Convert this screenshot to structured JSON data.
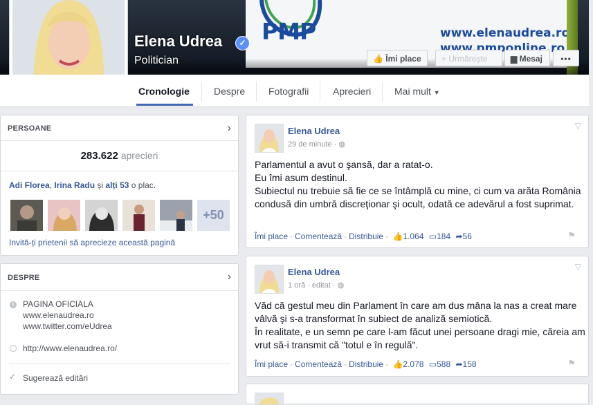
{
  "cover": {
    "logo_text": "PMP",
    "site_line1": "www.elenaudrea.ro",
    "site_line2": "www.pmponline.ro"
  },
  "page": {
    "name": "Elena Udrea",
    "category": "Politician"
  },
  "buttons": {
    "like": "Îmi place",
    "follow": "Urmărește",
    "message": "Mesaj",
    "more": "•••"
  },
  "tabs": [
    "Cronologie",
    "Despre",
    "Fotografii",
    "Aprecieri",
    "Mai mult"
  ],
  "people": {
    "header": "PERSOANE",
    "likes_count": "283.622",
    "likes_label": "aprecieri",
    "friends_line": {
      "name1": "Adi Florea",
      "sep": ", ",
      "name2": "Irina Radu",
      "and": " și ",
      "others": "alți 53",
      "tail": " o plac."
    },
    "more_friends": "+50",
    "invite": "Invită-ți prietenii să aprecieze această pagină"
  },
  "about": {
    "header": "DESPRE",
    "official_title": "PAGINA OFICIALA",
    "official_link1": "www.elenaudrea.ro",
    "official_link2": "www.twitter.com/eUdrea",
    "website": "http://www.elenaudrea.ro/",
    "suggest": "Sugerează editări"
  },
  "posts": [
    {
      "author": "Elena Udrea",
      "time": "29 de minute",
      "edited": "",
      "body": "Parlamentul a avut o şansă, dar a ratat-o.\nEu îmi asum destinul.\nSubiectul nu trebuie să fie ce se întâmplă cu mine, ci cum va arăta România condusă din umbră discreţionar şi ocult, odată ce adevărul a fost suprimat.",
      "like": "Îmi place",
      "comment": "Comentează",
      "share": "Distribuie",
      "likes": "1.064",
      "comments": "184",
      "shares": "56"
    },
    {
      "author": "Elena Udrea",
      "time": "1 oră",
      "edited": "editat",
      "body": "Văd că gestul meu din Parlament în care am dus mâna la nas a creat mare vâlvă şi s-a transformat în subiect de analiză semiotică.\nÎn realitate, e un semn pe care l-am făcut unei persoane dragi mie, căreia am vrut să-i transmit că \"totul e în regulă\".",
      "like": "Îmi place",
      "comment": "Comentează",
      "share": "Distribuie",
      "likes": "2.078",
      "comments": "588",
      "shares": "158"
    }
  ],
  "colors": {
    "fb_blue": "#365899",
    "accent": "#4267b2",
    "verified": "#5890ff",
    "pmp_blue": "#1a4b9c"
  }
}
